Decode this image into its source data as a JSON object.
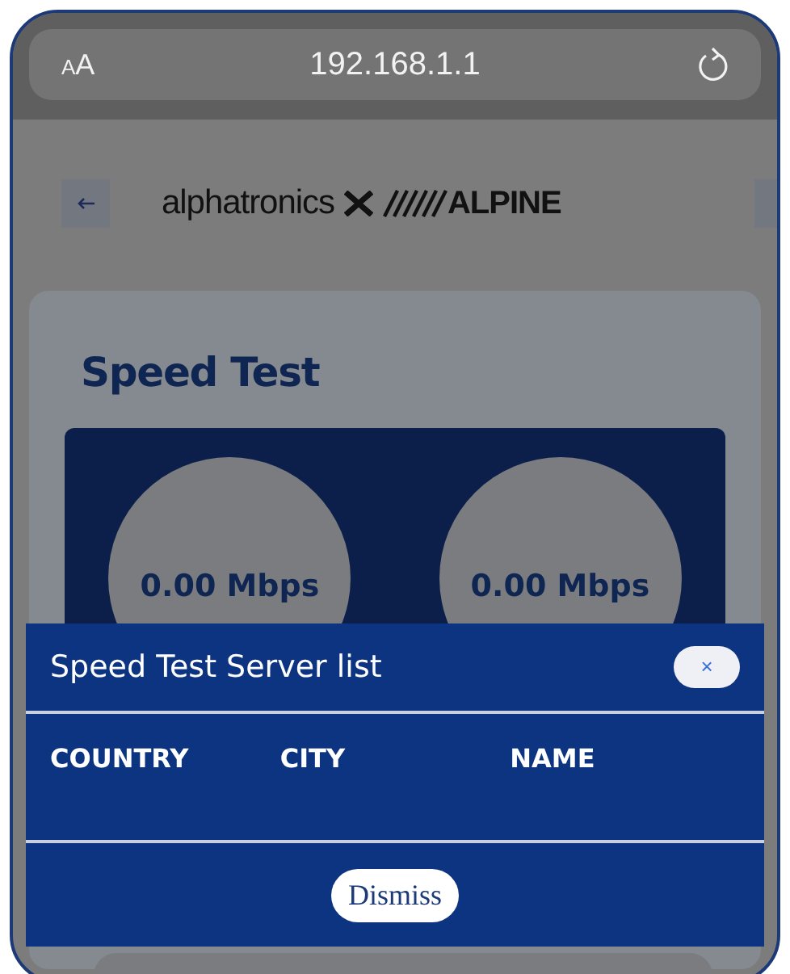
{
  "browser": {
    "text_size_label": "AA",
    "url": "192.168.1.1"
  },
  "header": {
    "logo_left": "alphatronics",
    "logo_right": "ALPINE"
  },
  "card": {
    "title": "Speed Test",
    "gauges": [
      {
        "reading": "0.00 Mbps"
      },
      {
        "reading": "0.00 Mbps"
      }
    ]
  },
  "modal": {
    "title": "Speed Test Server list",
    "close_label": "×",
    "columns": [
      "COUNTRY",
      "CITY",
      "NAME"
    ],
    "dismiss_label": "Dismiss"
  }
}
